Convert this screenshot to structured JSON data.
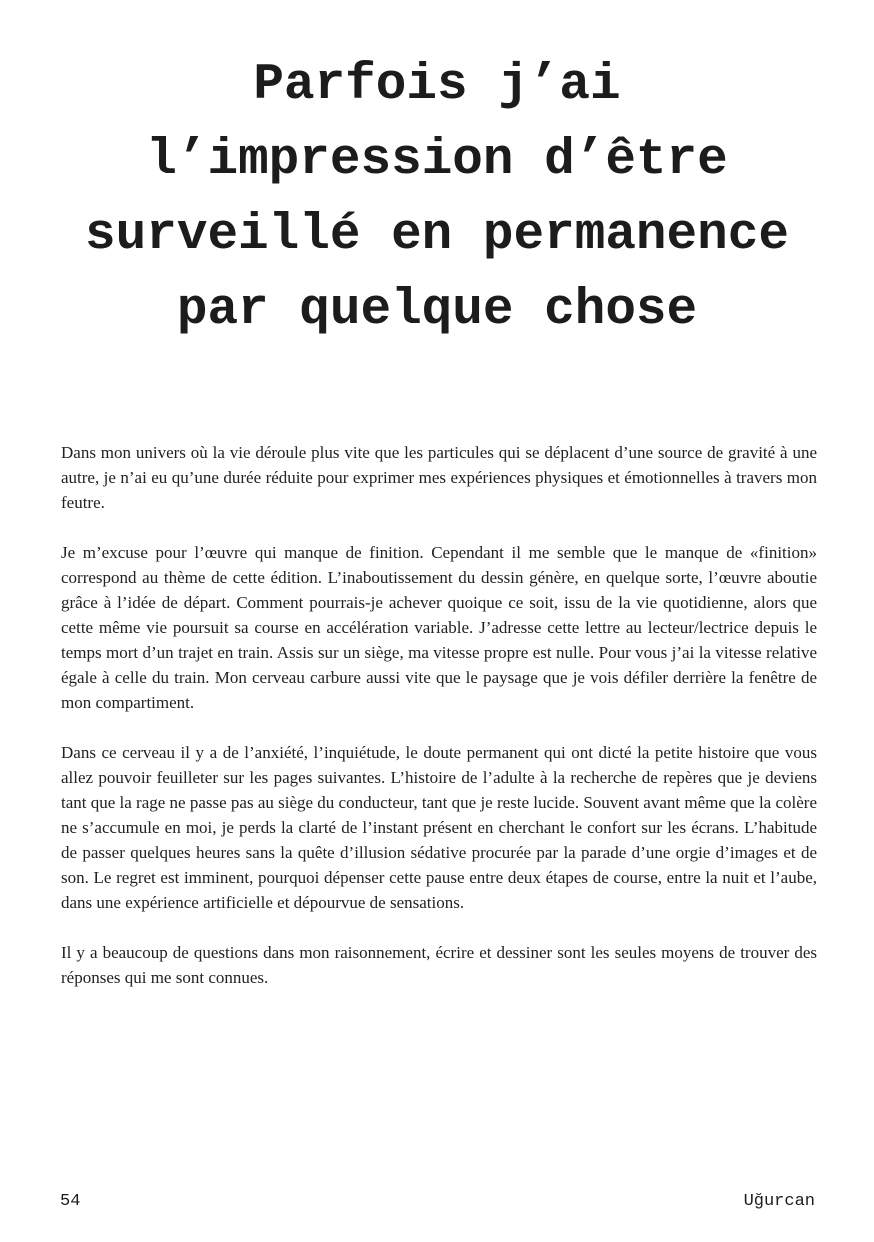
{
  "title_lines": [
    "Parfois j’ai",
    "l’impression d’être",
    "surveillé en permanence",
    "par quelque chose"
  ],
  "paragraphs": [
    "Dans mon univers où la vie déroule plus vite que les particules qui se déplacent d’une source de gravité à une autre, je n’ai eu qu’une durée réduite pour exprimer mes expériences physiques et émotionnelles à travers mon feutre.",
    "Je m’excuse pour l’œuvre qui manque de finition. Cependant il me semble que le manque de «finition» correspond au thème de cette édition. L’inaboutissement du dessin génère, en quelque sorte, l’œuvre aboutie grâce à l’idée de départ. Comment pourrais-je achever quoique ce soit, issu de la vie quotidienne, alors que cette même vie poursuit sa course en accélération variable. J’adresse cette lettre au lecteur/lectrice depuis le temps mort d’un trajet en train. Assis sur un siège, ma vitesse propre est nulle. Pour vous j’ai la vitesse relative égale à celle du train. Mon cerveau carbure aussi vite que le paysage que je vois défiler derrière la fenêtre de mon compartiment.",
    "Dans ce cerveau il y a de l’anxiété, l’inquiétude, le doute permanent qui ont dicté la petite histoire que vous allez pouvoir feuilleter sur les pages suivantes. L’histoire de l’adulte à la recherche de repères que je deviens tant que la rage ne passe pas au siège du conducteur, tant que je reste lucide. Souvent avant même que la colère ne s’accumule en moi, je perds la clarté de l’instant présent en cherchant le confort sur les écrans. L’habitude de passer quelques heures sans la quête d’illusion sédative procurée par la parade d’une orgie d’images et de son. Le regret est imminent, pourquoi dépenser cette pause entre deux étapes de course, entre la nuit et l’aube, dans une expérience artificielle et dépourvue de sensations.",
    "Il y a beaucoup de questions dans mon raisonnement, écrire et dessiner sont les seules moyens de trouver des réponses qui me sont connues."
  ],
  "footer": {
    "page_number": "54",
    "author": "Uğurcan"
  }
}
